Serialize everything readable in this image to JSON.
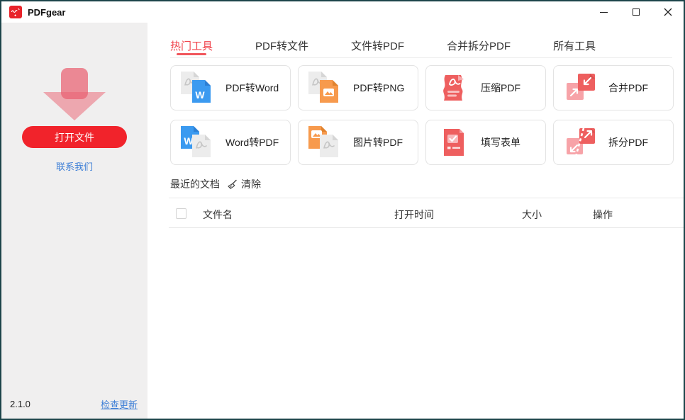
{
  "window": {
    "title": "PDFgear"
  },
  "sidebar": {
    "open_button": "打开文件",
    "contact_link": "联系我们",
    "version": "2.1.0",
    "update_link": "检查更新"
  },
  "tabs": [
    {
      "label": "热门工具",
      "active": true
    },
    {
      "label": "PDF转文件",
      "active": false
    },
    {
      "label": "文件转PDF",
      "active": false
    },
    {
      "label": "合并拆分PDF",
      "active": false
    },
    {
      "label": "所有工具",
      "active": false
    }
  ],
  "tools": [
    {
      "label": "PDF转Word",
      "icon": "pdf-to-word"
    },
    {
      "label": "PDF转PNG",
      "icon": "pdf-to-png"
    },
    {
      "label": "压缩PDF",
      "icon": "compress-pdf"
    },
    {
      "label": "合并PDF",
      "icon": "merge-pdf"
    },
    {
      "label": "Word转PDF",
      "icon": "word-to-pdf"
    },
    {
      "label": "图片转PDF",
      "icon": "image-to-pdf"
    },
    {
      "label": "填写表单",
      "icon": "fill-form"
    },
    {
      "label": "拆分PDF",
      "icon": "split-pdf"
    }
  ],
  "recent": {
    "title": "最近的文档",
    "clear_label": "清除",
    "columns": [
      "文件名",
      "打开时间",
      "大小",
      "操作"
    ],
    "rows": []
  },
  "icons": {
    "word_letter": "W"
  },
  "colors": {
    "accent_red": "#f1232b",
    "active_tab_red": "#f0434b",
    "link_blue": "#3e7fd6",
    "icon_red": "#ee5f5f",
    "icon_pink": "#f7a3a8",
    "icon_blue": "#3b9af0",
    "icon_orange": "#f79a4d",
    "sidebar_bg": "#f0efef",
    "window_border": "#1d454b"
  }
}
